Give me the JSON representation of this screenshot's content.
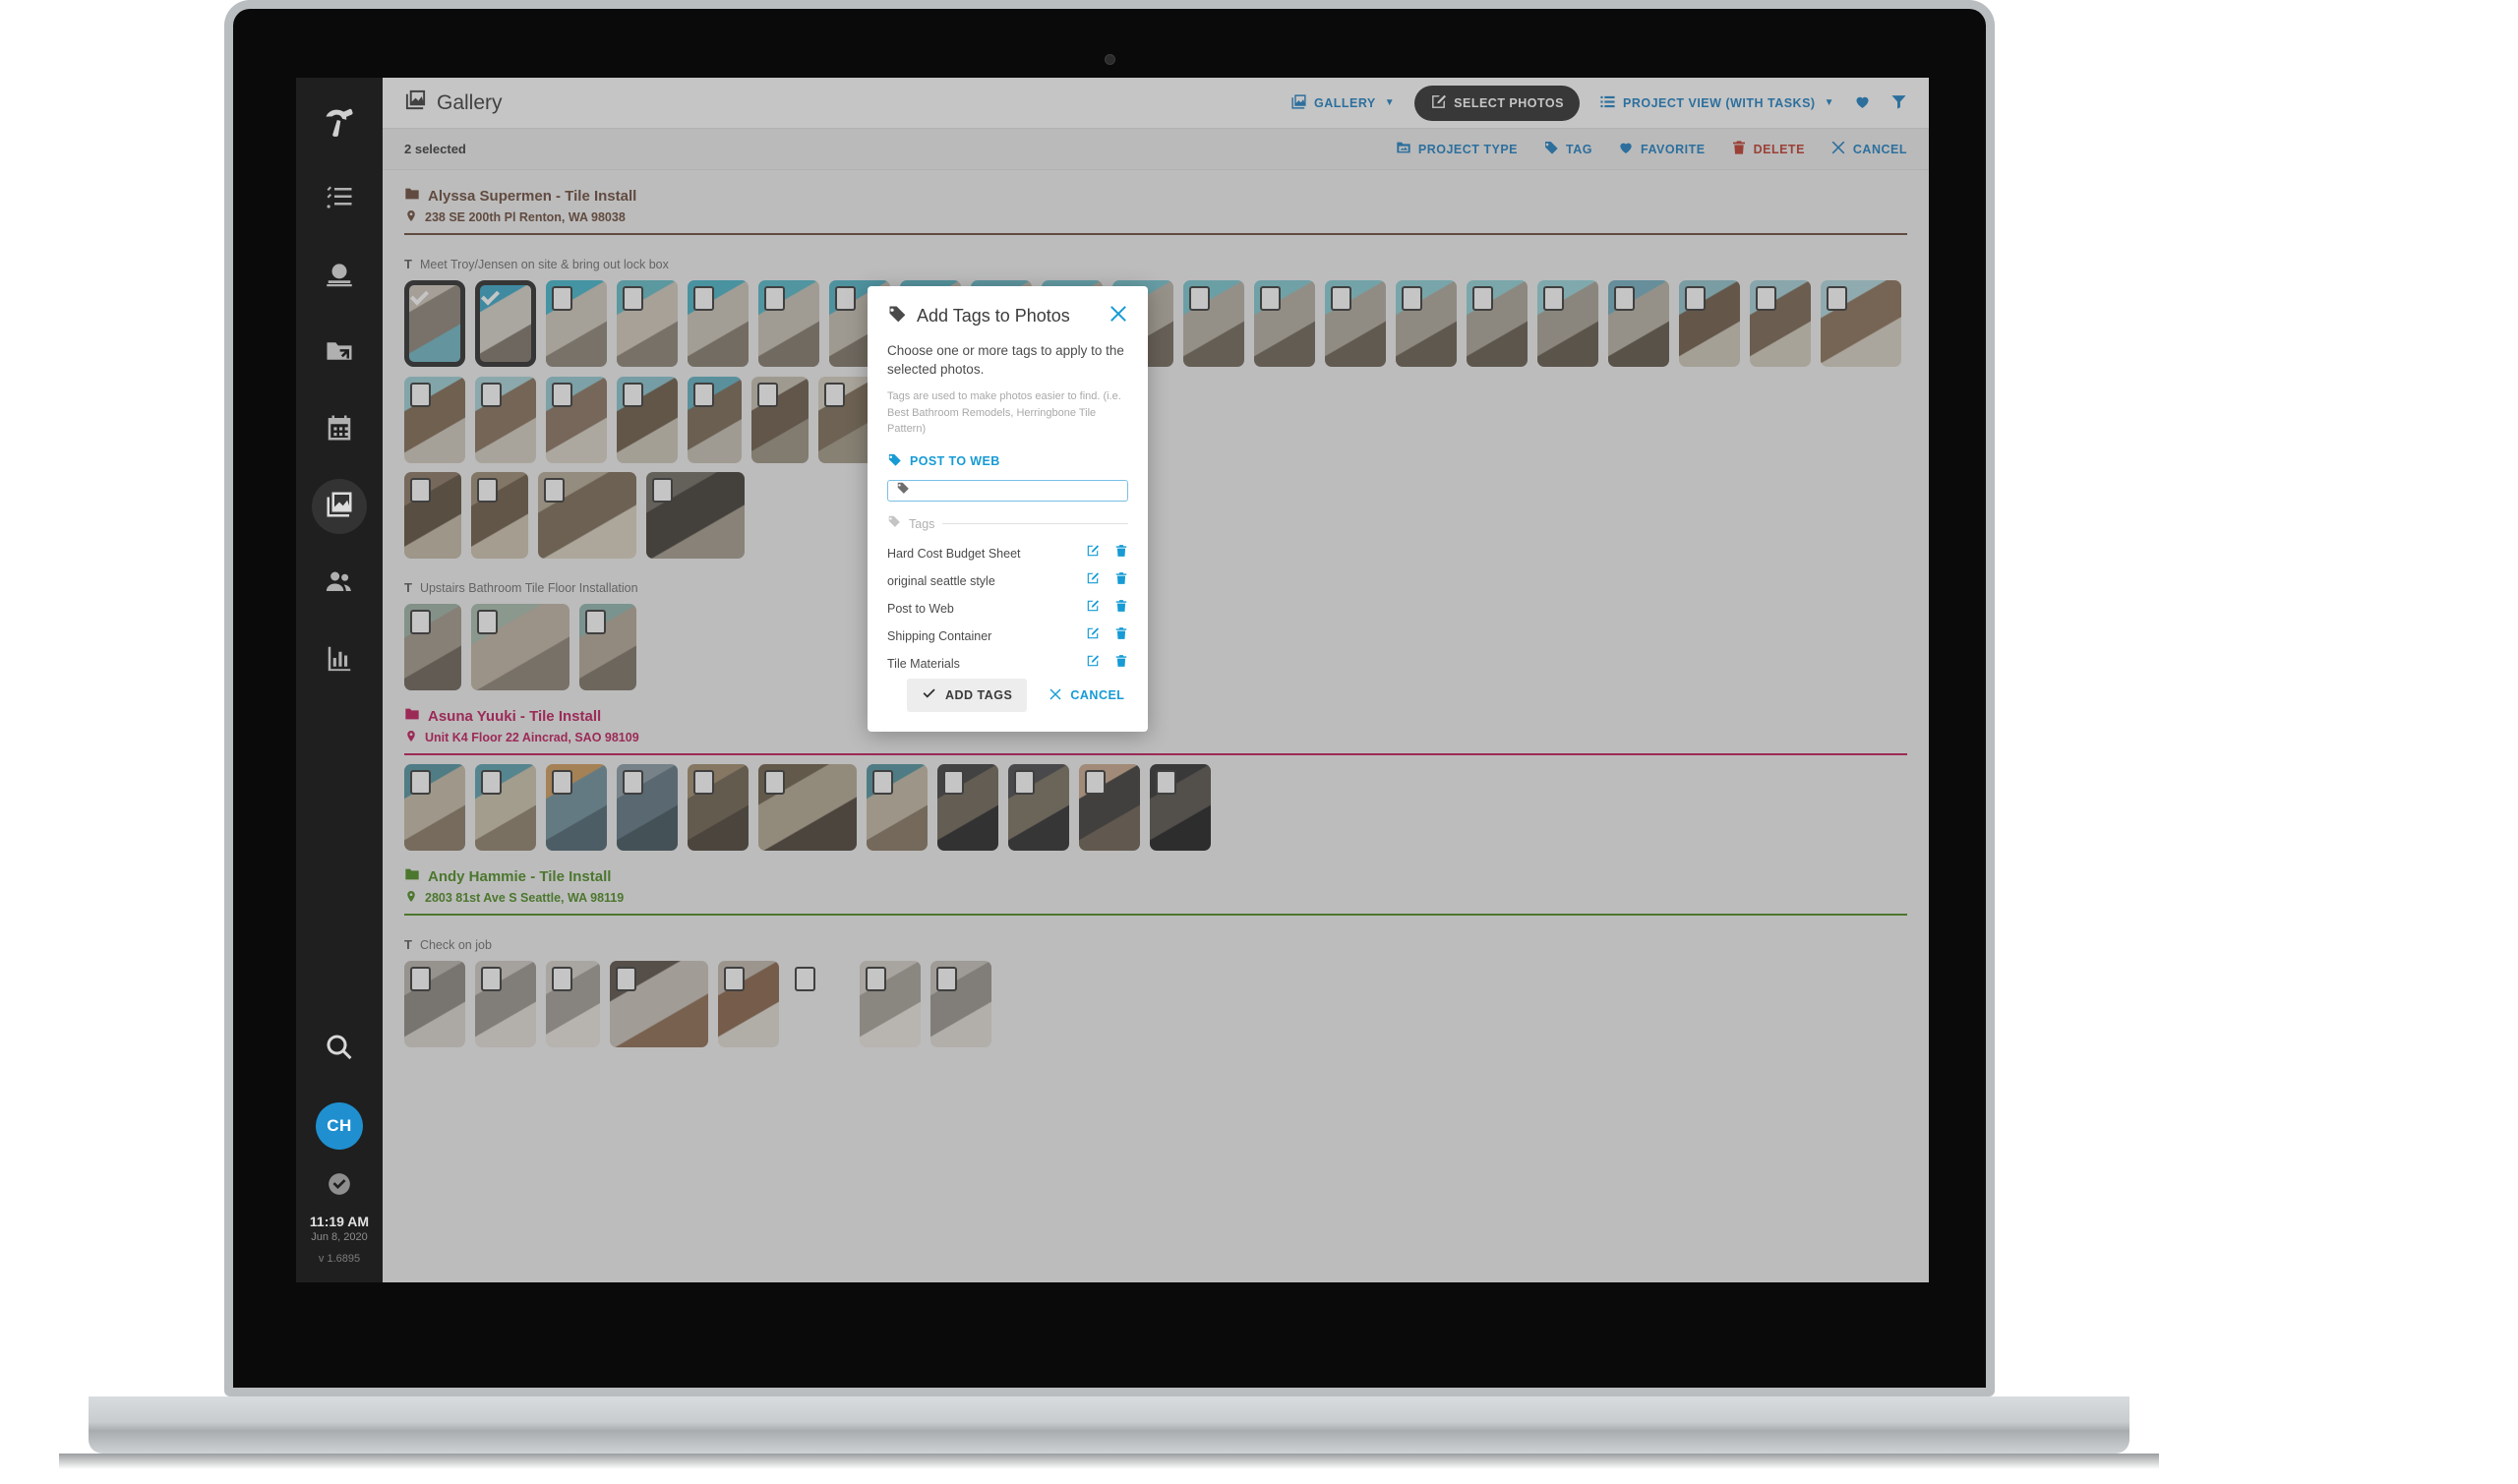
{
  "app": {
    "title": "Gallery",
    "title_icon": "gallery-icon"
  },
  "topbar": {
    "gallery_label": "GALLERY",
    "select_photos_label": "SELECT PHOTOS",
    "project_view_label": "PROJECT VIEW (WITH TASKS)",
    "favorite_icon": "heart-icon",
    "filter_icon": "funnel-icon",
    "caret": "▼"
  },
  "selection_bar": {
    "count_label": "2 selected",
    "actions": [
      {
        "label": "PROJECT TYPE",
        "icon": "folder-image-icon",
        "color": "#1b7fc4"
      },
      {
        "label": "TAG",
        "icon": "tag-icon",
        "color": "#1b7fc4"
      },
      {
        "label": "FAVORITE",
        "icon": "heart-icon",
        "color": "#1b7fc4"
      },
      {
        "label": "DELETE",
        "icon": "trash-icon",
        "color": "#c0392b"
      },
      {
        "label": "CANCEL",
        "icon": "close-icon",
        "color": "#1b7fc4"
      }
    ]
  },
  "sidebar": {
    "items": [
      {
        "icon": "hammer-logo-icon",
        "active": false
      },
      {
        "icon": "checklist-icon",
        "active": false
      },
      {
        "icon": "money-bag-icon",
        "active": false
      },
      {
        "icon": "folder-arrow-icon",
        "active": false
      },
      {
        "icon": "calendar-icon",
        "active": false
      },
      {
        "icon": "photos-icon",
        "active": true
      },
      {
        "icon": "people-icon",
        "active": false
      },
      {
        "icon": "bar-chart-icon",
        "active": false
      }
    ],
    "search_icon": "search-icon",
    "avatar_initials": "CH",
    "sync_icon": "check-circle-icon",
    "clock_time": "11:19 AM",
    "clock_date": "Jun 8, 2020",
    "version": "v 1.6895"
  },
  "projects": [
    {
      "name": "Alyssa Supermen - Tile Install",
      "address": "238 SE 200th Pl Renton, WA 98038",
      "color": "#6b4a3a",
      "tasks": [
        {
          "label": "Meet Troy/Jensen on site & bring out lock box",
          "photos": [
            {
              "selected": true,
              "w": 62,
              "c1": "#cfc7bc",
              "c2": "#8e8478",
              "c3": "#6fb6c4"
            },
            {
              "selected": true,
              "w": 62,
              "c1": "#3aa8c9",
              "c2": "#d7d2c8",
              "c3": "#7e7468"
            },
            {
              "selected": false,
              "w": 62,
              "c1": "#3fb6cd",
              "c2": "#cfc8bc",
              "c3": "#8d8376"
            },
            {
              "selected": false,
              "w": 62,
              "c1": "#62bcc6",
              "c2": "#d2cabd",
              "c3": "#8b8275"
            },
            {
              "selected": false,
              "w": 62,
              "c1": "#46b4c8",
              "c2": "#cdc5b8",
              "c3": "#857b6e"
            },
            {
              "selected": false,
              "w": 62,
              "c1": "#52b8c9",
              "c2": "#cac2b5",
              "c3": "#82786b"
            },
            {
              "selected": false,
              "w": 62,
              "c1": "#4fb3c6",
              "c2": "#c7bfb2",
              "c3": "#7f7568"
            },
            {
              "selected": false,
              "w": 62,
              "c1": "#5ab5c4",
              "c2": "#c4bcaf",
              "c3": "#7c7265"
            },
            {
              "selected": false,
              "w": 62,
              "c1": "#66b9c7",
              "c2": "#c1b9ac",
              "c3": "#796f62"
            },
            {
              "selected": false,
              "w": 62,
              "c1": "#6ec0cd",
              "c2": "#beb6a9",
              "c3": "#766c5f"
            },
            {
              "selected": false,
              "w": 62,
              "c1": "#73c3cf",
              "c2": "#bbb3a6",
              "c3": "#73695c"
            },
            {
              "selected": false,
              "w": 62,
              "c1": "#79c6d1",
              "c2": "#b8b0a3",
              "c3": "#706659"
            },
            {
              "selected": false,
              "w": 62,
              "c1": "#7fc9d3",
              "c2": "#b5ada0",
              "c3": "#6d6356"
            },
            {
              "selected": false,
              "w": 62,
              "c1": "#85ccd5",
              "c2": "#b2aa9d",
              "c3": "#6a6053"
            },
            {
              "selected": false,
              "w": 62,
              "c1": "#8bcfd7",
              "c2": "#afa79a",
              "c3": "#675d50"
            },
            {
              "selected": false,
              "w": 62,
              "c1": "#91d2d9",
              "c2": "#aca497",
              "c3": "#645a4d"
            },
            {
              "selected": false,
              "w": 62,
              "c1": "#97d5db",
              "c2": "#a9a194",
              "c3": "#61574a"
            },
            {
              "selected": false,
              "w": 62,
              "c1": "#72aec0",
              "c2": "#b8b2a5",
              "c3": "#5e5447"
            },
            {
              "selected": false,
              "w": 62,
              "c1": "#8fc2cd",
              "c2": "#6f5b48",
              "c3": "#cfc8ba"
            },
            {
              "selected": false,
              "w": 62,
              "c1": "#a4d1d8",
              "c2": "#7a6450",
              "c3": "#d3ccbe"
            },
            {
              "selected": false,
              "w": 82,
              "c1": "#b0d8de",
              "c2": "#8a7158",
              "c3": "#d8d1c3"
            },
            {
              "selected": false,
              "w": 62,
              "c1": "#9ccfd6",
              "c2": "#7f6951",
              "c3": "#d1cabc"
            },
            {
              "selected": false,
              "w": 62,
              "c1": "#a9d4da",
              "c2": "#86705a",
              "c3": "#d5cec0"
            },
            {
              "selected": false,
              "w": 62,
              "c1": "#93c9d2",
              "c2": "#8a7460",
              "c3": "#dbd4c6"
            },
            {
              "selected": false,
              "w": 62,
              "c1": "#88c4cf",
              "c2": "#6c5a46",
              "c3": "#cdc6b8"
            },
            {
              "selected": false,
              "w": 55,
              "c1": "#5fb1c2",
              "c2": "#7a6854",
              "c3": "#c8c1b3"
            },
            {
              "selected": false,
              "w": 58,
              "c1": "#c6bfb1",
              "c2": "#6a5a46",
              "c3": "#9a927f"
            },
            {
              "selected": false,
              "w": 58,
              "c1": "#d6cfc1",
              "c2": "#7d6c55",
              "c3": "#a39a87"
            },
            {
              "selected": false,
              "w": 58,
              "c1": "#cdc6b8",
              "c2": "#6f5e4a",
              "c3": "#968d7a"
            },
            {
              "selected": false,
              "w": 50,
              "c1": "#dcd5c7",
              "c2": "#857459",
              "c3": "#a9a08d"
            },
            {
              "selected": false,
              "w": 55,
              "c1": "#c2bbad",
              "c2": "#6c5b47",
              "c3": "#8f8673"
            }
          ],
          "row2": [
            {
              "selected": false,
              "w": 58,
              "c1": "#8a7560",
              "c2": "#5f4e3c",
              "c3": "#c3b9a6"
            },
            {
              "selected": false,
              "w": 58,
              "c1": "#9c8a72",
              "c2": "#6c5a45",
              "c3": "#cec3b0"
            },
            {
              "selected": false,
              "w": 100,
              "c1": "#b7ab96",
              "c2": "#7b6a55",
              "c3": "#dcd2c0"
            },
            {
              "selected": false,
              "w": 100,
              "c1": "#6f6a62",
              "c2": "#3f3a33",
              "c3": "#a59c8c"
            }
          ]
        },
        {
          "label": "Upstairs Bathroom Tile Floor Installation",
          "photos": [
            {
              "selected": false,
              "w": 58,
              "c1": "#9db2a6",
              "c2": "#a3988a",
              "c3": "#6b6257"
            },
            {
              "selected": false,
              "w": 100,
              "c1": "#a8bcae",
              "c2": "#c0b5a4",
              "c3": "#8d8275"
            },
            {
              "selected": false,
              "w": 58,
              "c1": "#8fb5ad",
              "c2": "#b3a797",
              "c3": "#7c7265"
            }
          ]
        }
      ]
    },
    {
      "name": "Asuna Yuuki - Tile Install",
      "address": "Unit K4 Floor 22 Aincrad, SAO 98109",
      "color": "#c2185b",
      "tasks": [
        {
          "label": "",
          "photos": [
            {
              "selected": false,
              "w": 62,
              "c1": "#4f93a0",
              "c2": "#c7bda8",
              "c3": "#8a7a64"
            },
            {
              "selected": false,
              "w": 62,
              "c1": "#58a0ad",
              "c2": "#cdc3ae",
              "c3": "#90806a"
            },
            {
              "selected": false,
              "w": 62,
              "c1": "#d09a5a",
              "c2": "#6f8f9c",
              "c3": "#4c6470"
            },
            {
              "selected": false,
              "w": 62,
              "c1": "#8a9aa4",
              "c2": "#5f7582",
              "c3": "#3f525c"
            },
            {
              "selected": false,
              "w": 62,
              "c1": "#a08b6a",
              "c2": "#6f6250",
              "c3": "#4a4136"
            },
            {
              "selected": false,
              "w": 100,
              "c1": "#6e5e4a",
              "c2": "#b4a992",
              "c3": "#4a4036"
            },
            {
              "selected": false,
              "w": 62,
              "c1": "#50929f",
              "c2": "#c4baa5",
              "c3": "#877761"
            },
            {
              "selected": false,
              "w": 62,
              "c1": "#3c3c3c",
              "c2": "#6f6456",
              "c3": "#252525"
            },
            {
              "selected": false,
              "w": 62,
              "c1": "#47474a",
              "c2": "#7a6f5f",
              "c3": "#2a2a2c"
            },
            {
              "selected": false,
              "w": 62,
              "c1": "#c9a98c",
              "c2": "#3d3a36",
              "c3": "#6b5f50"
            },
            {
              "selected": false,
              "w": 62,
              "c1": "#2f2f31",
              "c2": "#55504a",
              "c3": "#1d1d1f"
            }
          ]
        }
      ]
    },
    {
      "name": "Andy Hammie - Tile Install",
      "address": "2803 81st Ave S Seattle, WA 98119",
      "color": "#4b8b1f",
      "tasks": [
        {
          "label": "Check on job",
          "photos": [
            {
              "selected": false,
              "w": 62,
              "c1": "#b9b3ad",
              "c2": "#8d8781",
              "c3": "#dad5cf"
            },
            {
              "selected": false,
              "w": 62,
              "c1": "#cfc9c3",
              "c2": "#9a948e",
              "c3": "#e5e0da"
            },
            {
              "selected": false,
              "w": 55,
              "c1": "#d6d1cb",
              "c2": "#a39d97",
              "c3": "#eae5df"
            },
            {
              "selected": false,
              "w": 100,
              "c1": "#5a5047",
              "c2": "#c9c2b8",
              "c3": "#8d6a4e"
            },
            {
              "selected": false,
              "w": 62,
              "c1": "#c0b8ae",
              "c2": "#8a6449",
              "c3": "#e1dbd3"
            },
            {
              "selected": false,
              "w": 62,
              "c1": "#cac4bc",
              "c2": "#9b9views",
              "c3": "#e6e1db"
            },
            {
              "selected": false,
              "w": 62,
              "c1": "#d4cec6",
              "c2": "#a7a199",
              "c3": "#ece7e1"
            },
            {
              "selected": false,
              "w": 62,
              "c1": "#c7c1b9",
              "c2": "#9a948c",
              "c3": "#e3ded8"
            }
          ]
        }
      ]
    }
  ],
  "modal": {
    "title": "Add Tags to Photos",
    "title_icon": "tag-icon",
    "close_icon": "close-icon",
    "description": "Choose one or more tags to apply to the selected photos.",
    "hint": "Tags are used to make photos easier to find. (i.e. Best Bathroom Remodels, Herringbone Tile Pattern)",
    "post_to_web_label": "POST TO WEB",
    "tag_input_value": "",
    "tag_input_placeholder": "",
    "tags_section_label": "Tags",
    "tags": [
      {
        "name": "Hard Cost Budget Sheet",
        "edit_icon": "edit-icon",
        "delete_icon": "trash-icon"
      },
      {
        "name": "original seattle style",
        "edit_icon": "edit-icon",
        "delete_icon": "trash-icon"
      },
      {
        "name": "Post to Web",
        "edit_icon": "edit-icon",
        "delete_icon": "trash-icon"
      },
      {
        "name": "Shipping Container",
        "edit_icon": "edit-icon",
        "delete_icon": "trash-icon"
      },
      {
        "name": "Tile Materials",
        "edit_icon": "edit-icon",
        "delete_icon": "trash-icon"
      }
    ],
    "add_button_label": "ADD TAGS",
    "cancel_button_label": "CANCEL"
  }
}
